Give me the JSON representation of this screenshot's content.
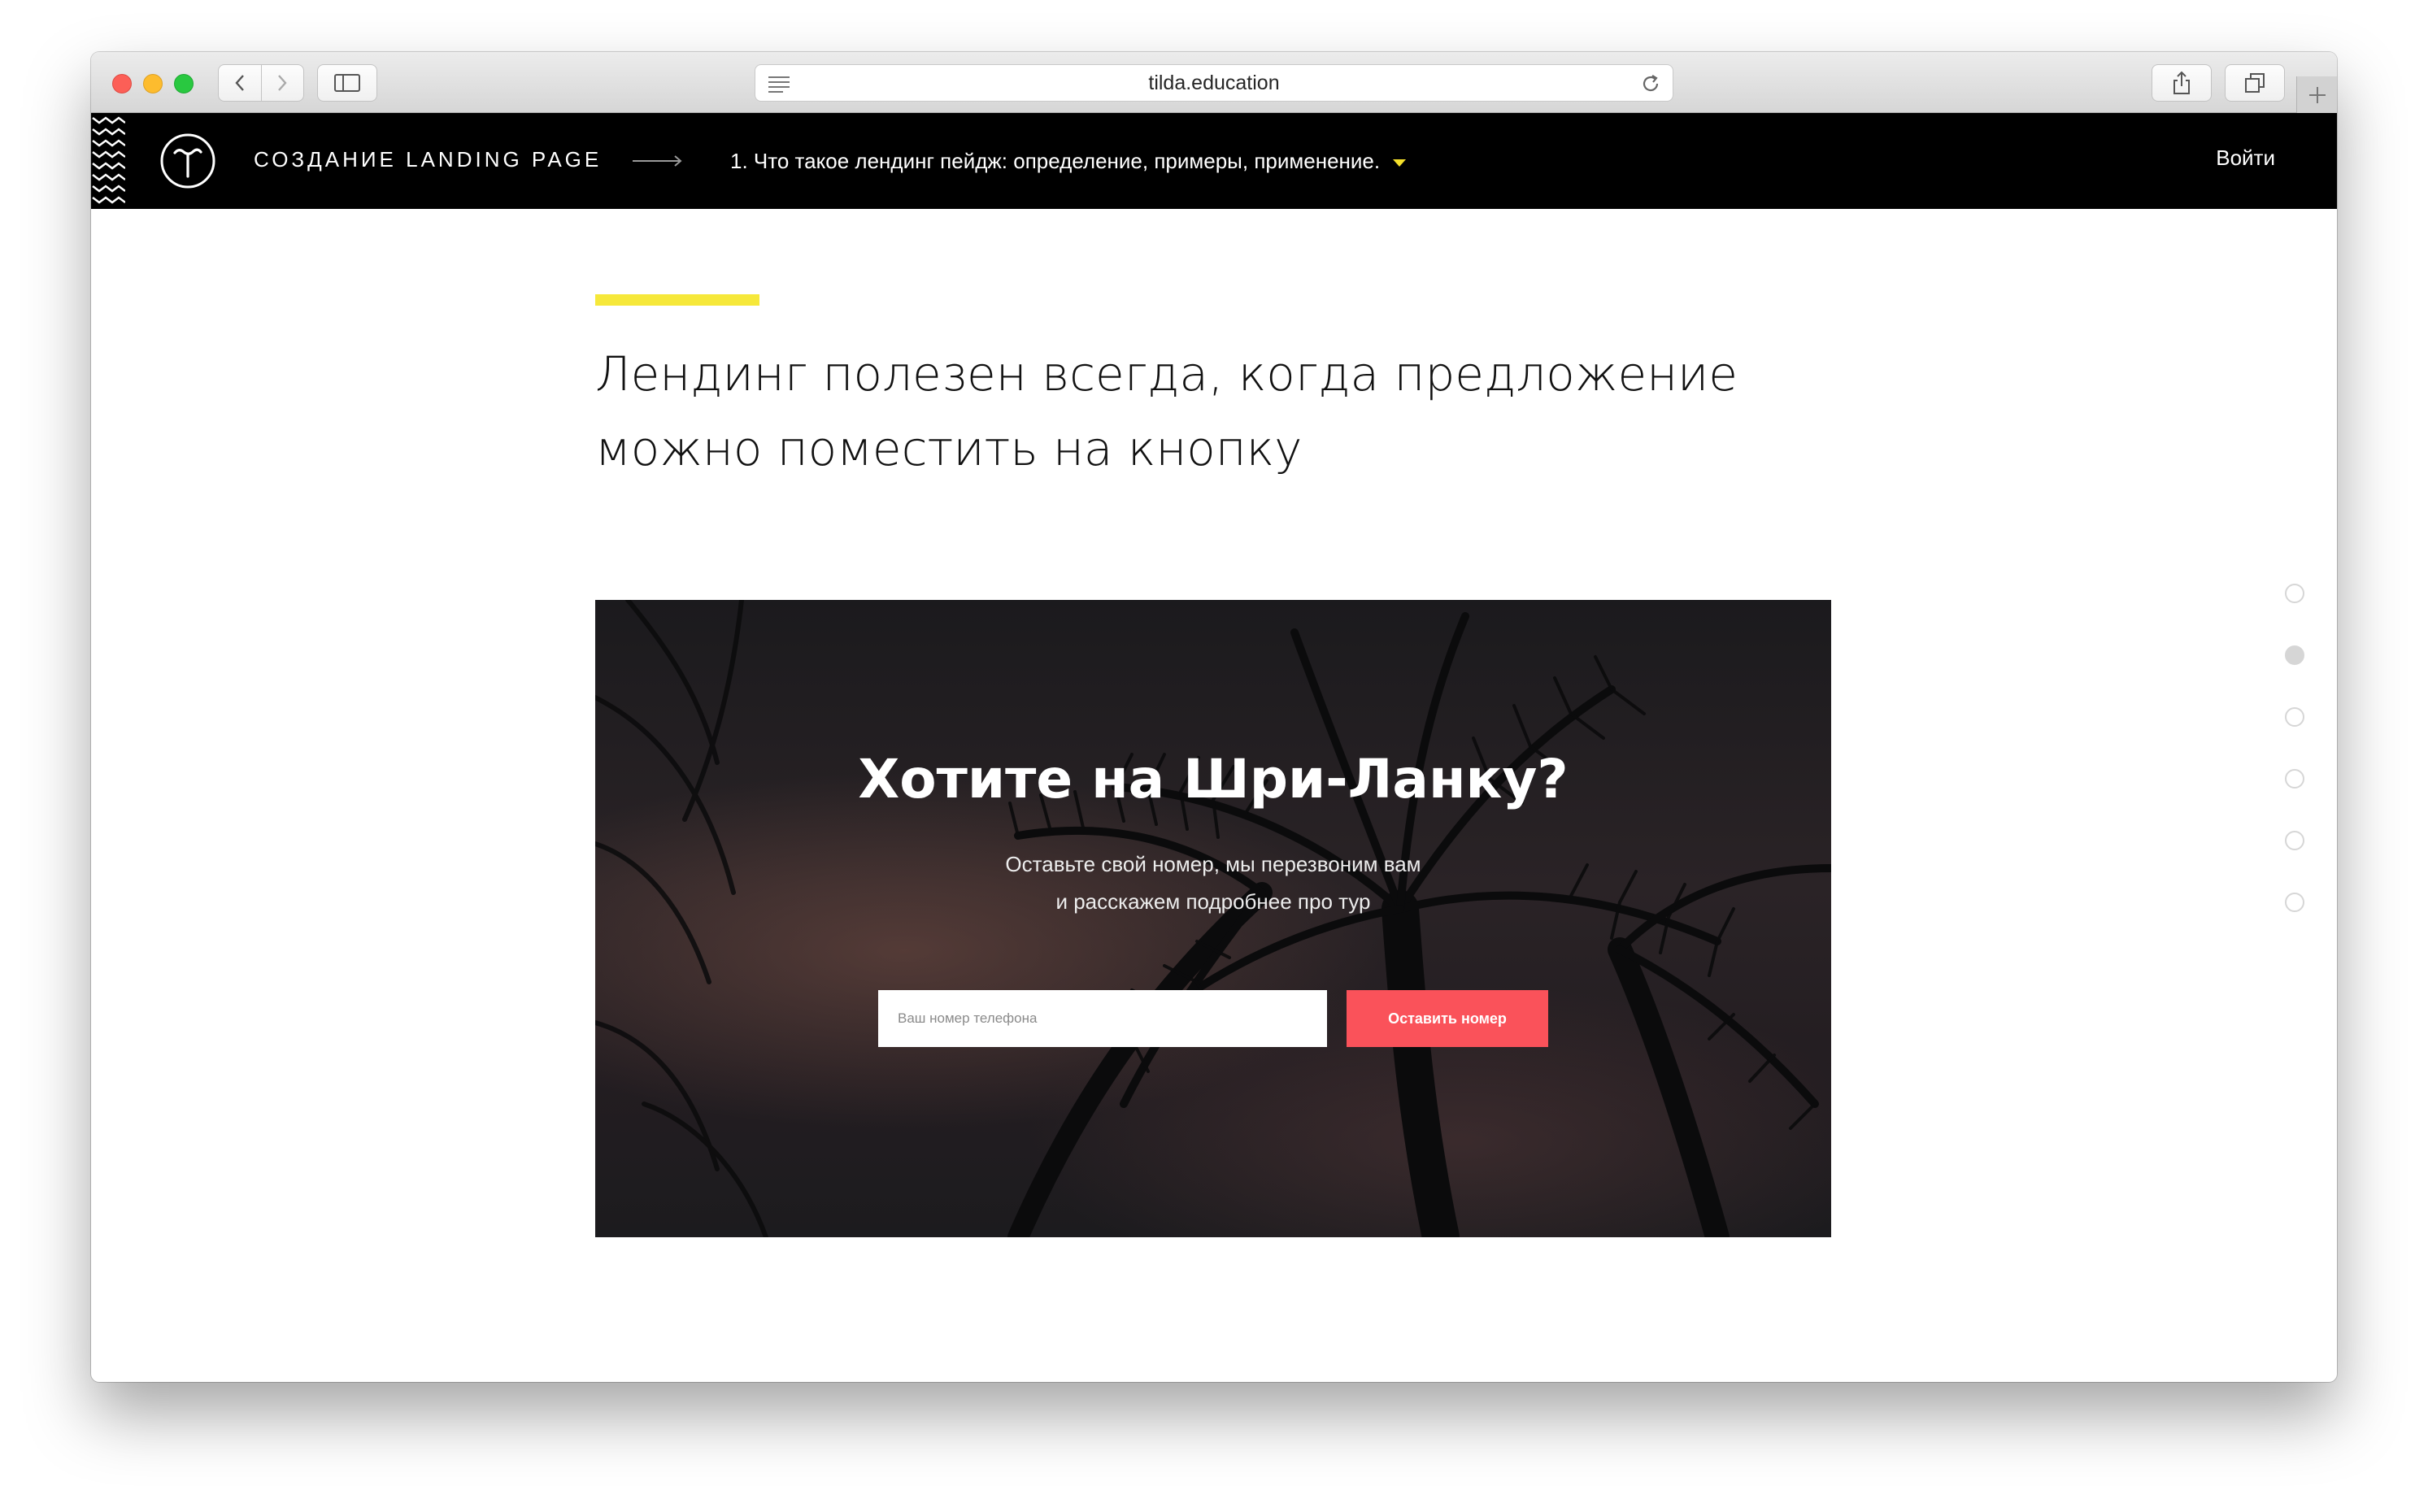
{
  "browser": {
    "url": "tilda.education"
  },
  "header": {
    "course_title": "СОЗДАНИЕ LANDING PAGE",
    "lesson_title": "1. Что такое лендинг пейдж: определение, примеры, применение.",
    "login_label": "Войти"
  },
  "main": {
    "headline_line1": "Лендинг полезен всегда, когда предложение",
    "headline_line2": "можно поместить на кнопку",
    "accent_color": "#f6e83a"
  },
  "banner": {
    "title": "Хотите на Шри-Ланку?",
    "subtitle_line1": "Оставьте свой номер, мы перезвоним вам",
    "subtitle_line2": "и расскажем подробнее про тур",
    "phone_placeholder": "Ваш номер телефона",
    "submit_label": "Оставить номер",
    "button_color": "#fa525a"
  },
  "side_nav": {
    "total": 6,
    "active_index": 1
  },
  "icons": [
    "back-icon",
    "forward-icon",
    "sidebar-icon",
    "reader-icon",
    "reload-icon",
    "share-icon",
    "tabs-icon",
    "plus-icon",
    "tilda-logo",
    "arrow-right-icon",
    "caret-down-icon"
  ]
}
